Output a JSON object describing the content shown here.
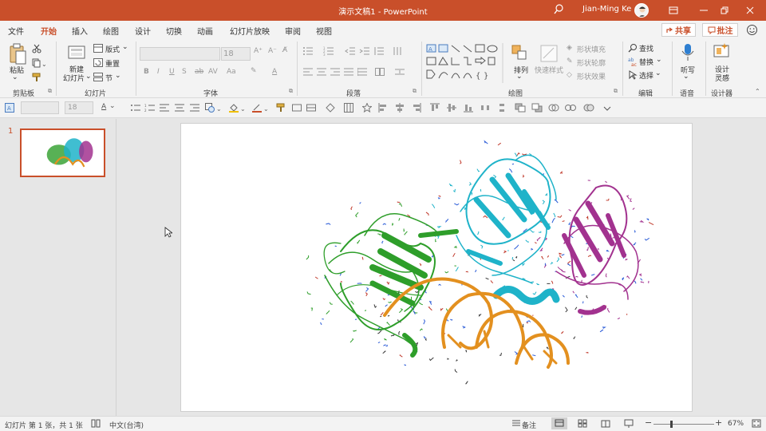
{
  "app": {
    "title": "演示文稿1  -  PowerPoint",
    "user_name": "Jian-Ming Ke"
  },
  "tabs": [
    "文件",
    "开始",
    "插入",
    "绘图",
    "设计",
    "切换",
    "动画",
    "幻灯片放映",
    "审阅",
    "视图"
  ],
  "active_tab": "开始",
  "share_label": "共享",
  "comment_label": "批注",
  "ribbon": {
    "clipboard": {
      "paste": "粘贴",
      "label": "剪贴板"
    },
    "slides": {
      "new_slide_1": "新建",
      "new_slide_2": "幻灯片",
      "layout": "版式",
      "reset": "重置",
      "section": "节",
      "label": "幻灯片"
    },
    "font": {
      "label": "字体",
      "font_size": "18"
    },
    "paragraph": {
      "label": "段落"
    },
    "drawing": {
      "arrange": "排列",
      "quick_styles": "快速样式",
      "shape_fill": "形状填充",
      "shape_outline": "形状轮廓",
      "shape_effects": "形状效果",
      "label": "绘图"
    },
    "editing": {
      "find": "查找",
      "replace": "替换",
      "select": "选择",
      "label": "编辑"
    },
    "voice": {
      "dictate": "听写",
      "label": "语音"
    },
    "designer": {
      "design_1": "设计",
      "design_2": "灵感",
      "label": "设计器"
    }
  },
  "format_toolbar": {
    "font_size": "18"
  },
  "thumbnails": [
    {
      "number": "1"
    }
  ],
  "status": {
    "slide_info": "幻灯片 第 1 张，共 1 张",
    "language": "中文(台湾)",
    "notes": "备注",
    "zoom": "67%"
  },
  "colors": {
    "accent": "#c94f2a",
    "protein_green": "#2e9e2a",
    "protein_cyan": "#1fb3c9",
    "protein_magenta": "#a2328f",
    "dna_orange": "#e3901f"
  }
}
